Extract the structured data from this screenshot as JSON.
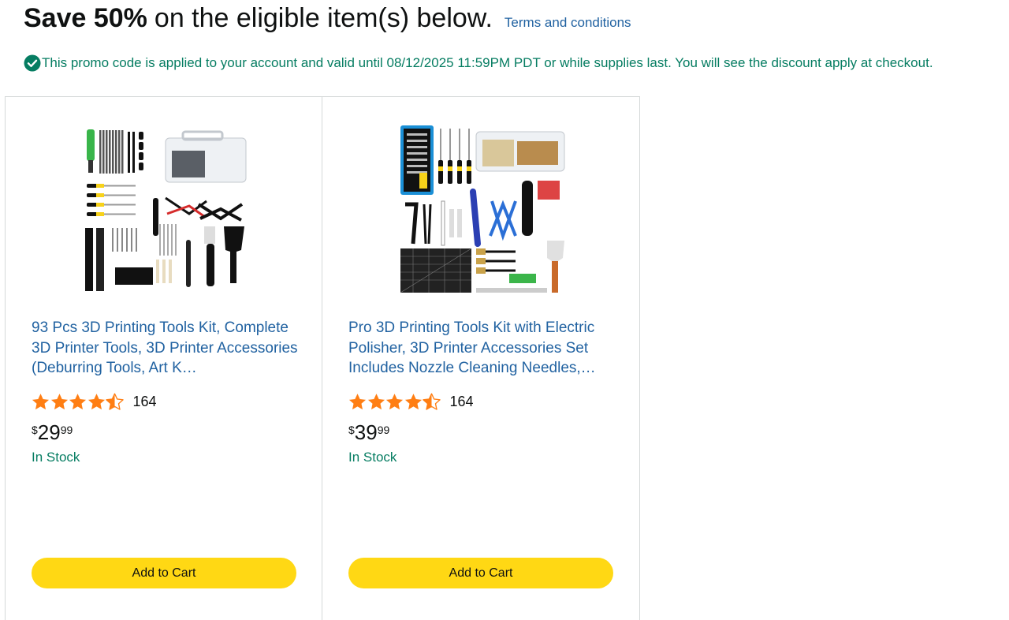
{
  "header": {
    "headline_bold": "Save 50%",
    "headline_rest": "on the eligible item(s) below.",
    "terms_link": "Terms and conditions"
  },
  "promo": {
    "icon": "check-circle-icon",
    "text": "This promo code is applied to your account and valid until 08/12/2025 11:59PM PDT or while supplies last. You will see the discount apply at checkout."
  },
  "colors": {
    "link": "#2162a1",
    "success": "#067d62",
    "star": "#ff7e13",
    "cart_button": "#ffd814"
  },
  "products": [
    {
      "image": "3d-printing-tools-kit-93pcs-image",
      "title": "93 Pcs 3D Printing Tools Kit, Complete 3D Printer Tools, 3D Printer Accessories (Deburring Tools, Art K…",
      "rating": 4.5,
      "review_count": "164",
      "price_symbol": "$",
      "price_whole": "29",
      "price_fraction": "99",
      "stock": "In Stock",
      "button": "Add to Cart"
    },
    {
      "image": "pro-3d-printing-tools-kit-electric-polisher-image",
      "title": "Pro 3D Printing Tools Kit with Electric Polisher, 3D Printer Accessories Set Includes Nozzle Cleaning Needles,…",
      "rating": 4.5,
      "review_count": "164",
      "price_symbol": "$",
      "price_whole": "39",
      "price_fraction": "99",
      "stock": "In Stock",
      "button": "Add to Cart"
    }
  ]
}
